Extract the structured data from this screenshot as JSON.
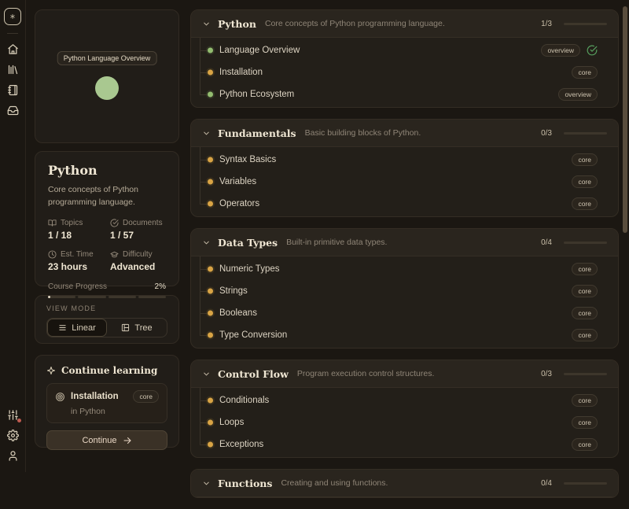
{
  "sidebar": {
    "top_icons": [
      {
        "name": "home"
      },
      {
        "name": "library"
      },
      {
        "name": "notebook"
      },
      {
        "name": "inbox"
      }
    ],
    "bottom_icons": [
      {
        "name": "sliders",
        "notification": true
      },
      {
        "name": "settings",
        "notification": false
      },
      {
        "name": "user",
        "notification": false
      }
    ]
  },
  "graph": {
    "node_label": "Python Language Overview",
    "node_color": "#a9c890"
  },
  "course": {
    "title": "Python",
    "description": "Core concepts of Python programming language.",
    "stats": [
      {
        "icon": "book-open",
        "label": "Topics",
        "value": "1 / 18"
      },
      {
        "icon": "check-circle",
        "label": "Documents",
        "value": "1 / 57"
      },
      {
        "icon": "clock",
        "label": "Est. Time",
        "value": "23 hours"
      },
      {
        "icon": "graduation-cap",
        "label": "Difficulty",
        "value": "Advanced"
      }
    ],
    "progress_label": "Course Progress",
    "progress_value": "2%",
    "progress_percent": 2,
    "progress_segments": 4
  },
  "view_mode": {
    "label": "VIEW MODE",
    "options": [
      {
        "label": "Linear",
        "icon": "list",
        "selected": true
      },
      {
        "label": "Tree",
        "icon": "tree",
        "selected": false
      }
    ]
  },
  "continue_learning": {
    "title": "Continue learning",
    "lesson": {
      "title": "Installation",
      "badge": "core",
      "subtitle": "in Python"
    },
    "button_label": "Continue"
  },
  "main": {
    "sections": [
      {
        "title": "Python",
        "subtitle": "Core concepts of Python programming language.",
        "count": "1/3",
        "percent": 33,
        "items": [
          {
            "label": "Language Overview",
            "dot": "green",
            "badge": "overview",
            "completed": true
          },
          {
            "label": "Installation",
            "dot": "amber",
            "badge": "core",
            "completed": false
          },
          {
            "label": "Python Ecosystem",
            "dot": "green",
            "badge": "overview",
            "completed": false
          }
        ]
      },
      {
        "title": "Fundamentals",
        "subtitle": "Basic building blocks of Python.",
        "count": "0/3",
        "percent": 0,
        "items": [
          {
            "label": "Syntax Basics",
            "dot": "amber",
            "badge": "core",
            "completed": false
          },
          {
            "label": "Variables",
            "dot": "amber",
            "badge": "core",
            "completed": false
          },
          {
            "label": "Operators",
            "dot": "amber",
            "badge": "core",
            "completed": false
          }
        ]
      },
      {
        "title": "Data Types",
        "subtitle": "Built-in primitive data types.",
        "count": "0/4",
        "percent": 0,
        "items": [
          {
            "label": "Numeric Types",
            "dot": "amber",
            "badge": "core",
            "completed": false
          },
          {
            "label": "Strings",
            "dot": "amber",
            "badge": "core",
            "completed": false
          },
          {
            "label": "Booleans",
            "dot": "amber",
            "badge": "core",
            "completed": false
          },
          {
            "label": "Type Conversion",
            "dot": "amber",
            "badge": "core",
            "completed": false
          }
        ]
      },
      {
        "title": "Control Flow",
        "subtitle": "Program execution control structures.",
        "count": "0/3",
        "percent": 0,
        "items": [
          {
            "label": "Conditionals",
            "dot": "amber",
            "badge": "core",
            "completed": false
          },
          {
            "label": "Loops",
            "dot": "amber",
            "badge": "core",
            "completed": false
          },
          {
            "label": "Exceptions",
            "dot": "amber",
            "badge": "core",
            "completed": false
          }
        ]
      },
      {
        "title": "Functions",
        "subtitle": "Creating and using functions.",
        "count": "0/4",
        "percent": 0,
        "items": []
      }
    ]
  },
  "colors": {
    "accent_cream": "#e9dfca",
    "amber": "#d9a445",
    "green": "#93bd70",
    "check_green": "#57a05f",
    "node_green": "#a9c890",
    "notification_red": "#c05b50"
  }
}
